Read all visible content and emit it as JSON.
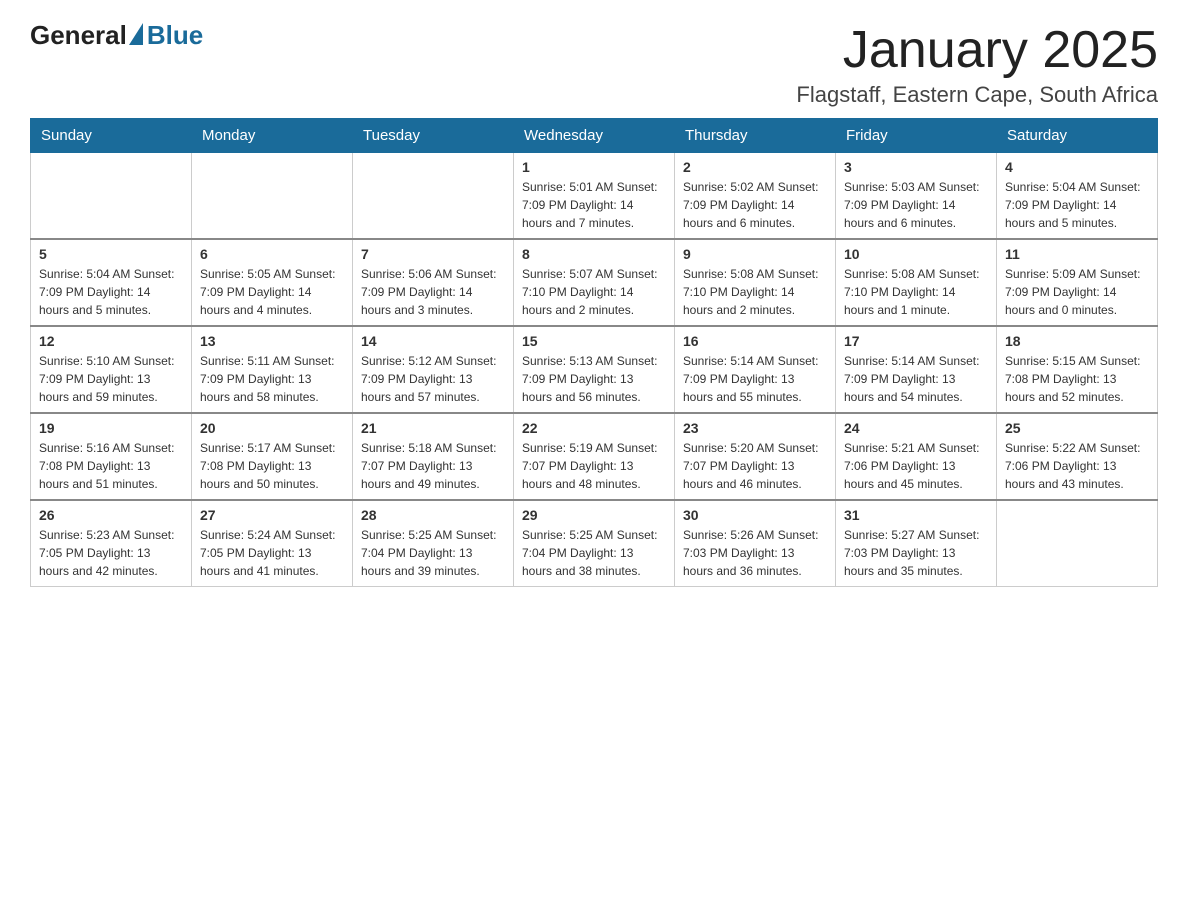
{
  "header": {
    "logo_general": "General",
    "logo_blue": "Blue",
    "title": "January 2025",
    "subtitle": "Flagstaff, Eastern Cape, South Africa"
  },
  "calendar": {
    "days_of_week": [
      "Sunday",
      "Monday",
      "Tuesday",
      "Wednesday",
      "Thursday",
      "Friday",
      "Saturday"
    ],
    "weeks": [
      [
        {
          "day": "",
          "info": ""
        },
        {
          "day": "",
          "info": ""
        },
        {
          "day": "",
          "info": ""
        },
        {
          "day": "1",
          "info": "Sunrise: 5:01 AM\nSunset: 7:09 PM\nDaylight: 14 hours and 7 minutes."
        },
        {
          "day": "2",
          "info": "Sunrise: 5:02 AM\nSunset: 7:09 PM\nDaylight: 14 hours and 6 minutes."
        },
        {
          "day": "3",
          "info": "Sunrise: 5:03 AM\nSunset: 7:09 PM\nDaylight: 14 hours and 6 minutes."
        },
        {
          "day": "4",
          "info": "Sunrise: 5:04 AM\nSunset: 7:09 PM\nDaylight: 14 hours and 5 minutes."
        }
      ],
      [
        {
          "day": "5",
          "info": "Sunrise: 5:04 AM\nSunset: 7:09 PM\nDaylight: 14 hours and 5 minutes."
        },
        {
          "day": "6",
          "info": "Sunrise: 5:05 AM\nSunset: 7:09 PM\nDaylight: 14 hours and 4 minutes."
        },
        {
          "day": "7",
          "info": "Sunrise: 5:06 AM\nSunset: 7:09 PM\nDaylight: 14 hours and 3 minutes."
        },
        {
          "day": "8",
          "info": "Sunrise: 5:07 AM\nSunset: 7:10 PM\nDaylight: 14 hours and 2 minutes."
        },
        {
          "day": "9",
          "info": "Sunrise: 5:08 AM\nSunset: 7:10 PM\nDaylight: 14 hours and 2 minutes."
        },
        {
          "day": "10",
          "info": "Sunrise: 5:08 AM\nSunset: 7:10 PM\nDaylight: 14 hours and 1 minute."
        },
        {
          "day": "11",
          "info": "Sunrise: 5:09 AM\nSunset: 7:09 PM\nDaylight: 14 hours and 0 minutes."
        }
      ],
      [
        {
          "day": "12",
          "info": "Sunrise: 5:10 AM\nSunset: 7:09 PM\nDaylight: 13 hours and 59 minutes."
        },
        {
          "day": "13",
          "info": "Sunrise: 5:11 AM\nSunset: 7:09 PM\nDaylight: 13 hours and 58 minutes."
        },
        {
          "day": "14",
          "info": "Sunrise: 5:12 AM\nSunset: 7:09 PM\nDaylight: 13 hours and 57 minutes."
        },
        {
          "day": "15",
          "info": "Sunrise: 5:13 AM\nSunset: 7:09 PM\nDaylight: 13 hours and 56 minutes."
        },
        {
          "day": "16",
          "info": "Sunrise: 5:14 AM\nSunset: 7:09 PM\nDaylight: 13 hours and 55 minutes."
        },
        {
          "day": "17",
          "info": "Sunrise: 5:14 AM\nSunset: 7:09 PM\nDaylight: 13 hours and 54 minutes."
        },
        {
          "day": "18",
          "info": "Sunrise: 5:15 AM\nSunset: 7:08 PM\nDaylight: 13 hours and 52 minutes."
        }
      ],
      [
        {
          "day": "19",
          "info": "Sunrise: 5:16 AM\nSunset: 7:08 PM\nDaylight: 13 hours and 51 minutes."
        },
        {
          "day": "20",
          "info": "Sunrise: 5:17 AM\nSunset: 7:08 PM\nDaylight: 13 hours and 50 minutes."
        },
        {
          "day": "21",
          "info": "Sunrise: 5:18 AM\nSunset: 7:07 PM\nDaylight: 13 hours and 49 minutes."
        },
        {
          "day": "22",
          "info": "Sunrise: 5:19 AM\nSunset: 7:07 PM\nDaylight: 13 hours and 48 minutes."
        },
        {
          "day": "23",
          "info": "Sunrise: 5:20 AM\nSunset: 7:07 PM\nDaylight: 13 hours and 46 minutes."
        },
        {
          "day": "24",
          "info": "Sunrise: 5:21 AM\nSunset: 7:06 PM\nDaylight: 13 hours and 45 minutes."
        },
        {
          "day": "25",
          "info": "Sunrise: 5:22 AM\nSunset: 7:06 PM\nDaylight: 13 hours and 43 minutes."
        }
      ],
      [
        {
          "day": "26",
          "info": "Sunrise: 5:23 AM\nSunset: 7:05 PM\nDaylight: 13 hours and 42 minutes."
        },
        {
          "day": "27",
          "info": "Sunrise: 5:24 AM\nSunset: 7:05 PM\nDaylight: 13 hours and 41 minutes."
        },
        {
          "day": "28",
          "info": "Sunrise: 5:25 AM\nSunset: 7:04 PM\nDaylight: 13 hours and 39 minutes."
        },
        {
          "day": "29",
          "info": "Sunrise: 5:25 AM\nSunset: 7:04 PM\nDaylight: 13 hours and 38 minutes."
        },
        {
          "day": "30",
          "info": "Sunrise: 5:26 AM\nSunset: 7:03 PM\nDaylight: 13 hours and 36 minutes."
        },
        {
          "day": "31",
          "info": "Sunrise: 5:27 AM\nSunset: 7:03 PM\nDaylight: 13 hours and 35 minutes."
        },
        {
          "day": "",
          "info": ""
        }
      ]
    ]
  }
}
